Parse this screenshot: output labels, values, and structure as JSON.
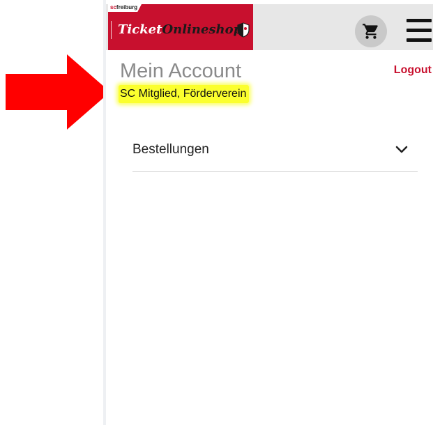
{
  "header": {
    "brand_small_sc": "sc",
    "brand_small_text": "freiburg",
    "brand_title_part1": "Ticket",
    "brand_title_part2": "Onlineshop",
    "brand_color": "#c8102e"
  },
  "account": {
    "title": "Mein Account",
    "logout_label": "Logout",
    "membership": "SC Mitglied, Förderverein"
  },
  "sections": {
    "orders_label": "Bestellungen"
  },
  "icons": {
    "cart": "cart-icon",
    "menu": "hamburger-menu-icon",
    "chevron": "chevron-down-icon",
    "arrow": "annotation-arrow"
  },
  "colors": {
    "accent": "#c8102e",
    "highlight": "#fbff2e",
    "header_bg": "#e7e7e7"
  }
}
